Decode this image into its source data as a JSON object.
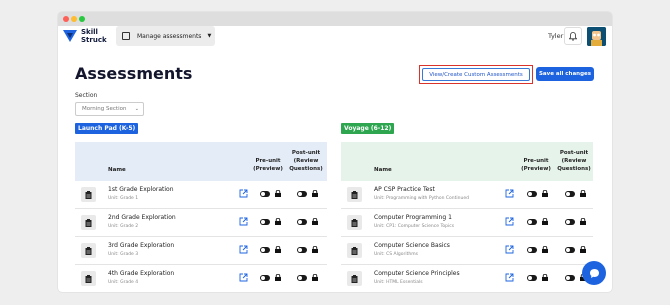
{
  "brand": {
    "line1": "Skill",
    "line2": "Struck"
  },
  "topbar": {
    "manage_label": "Manage assessments",
    "username": "Tyler"
  },
  "page": {
    "title": "Assessments",
    "view_custom_label": "View/Create Custom Assessments",
    "save_label": "Save all changes",
    "section_label": "Section",
    "section_value": "Morning Section"
  },
  "launchpad": {
    "badge": "Launch Pad (K-5)",
    "col_name": "Name",
    "col_pre": "Pre-unit (Preview)",
    "col_post": "Post-unit (Review Questions)",
    "rows": [
      {
        "name": "1st Grade Exploration",
        "unit": "Unit: Grade 1"
      },
      {
        "name": "2nd Grade Exploration",
        "unit": "Unit: Grade 2"
      },
      {
        "name": "3rd Grade Exploration",
        "unit": "Unit: Grade 3"
      },
      {
        "name": "4th Grade Exploration",
        "unit": "Unit: Grade 4"
      }
    ]
  },
  "voyage": {
    "badge": "Voyage (6-12)",
    "col_name": "Name",
    "col_pre": "Pre-unit (Preview)",
    "col_post": "Post-unit (Review Questions)",
    "rows": [
      {
        "name": "AP CSP Practice Test",
        "unit": "Unit: Programming with Python Continued"
      },
      {
        "name": "Computer Programming 1",
        "unit": "Unit: CP1: Computer Science Topics"
      },
      {
        "name": "Computer Science Basics",
        "unit": "Unit: CS Algorithms"
      },
      {
        "name": "Computer Science Principles",
        "unit": "Unit: HTML Essentials"
      }
    ]
  },
  "colors": {
    "accent": "#1d63e0",
    "launchpad": "#1d63e0",
    "voyage": "#2da64f",
    "highlight": "#d9332b"
  }
}
